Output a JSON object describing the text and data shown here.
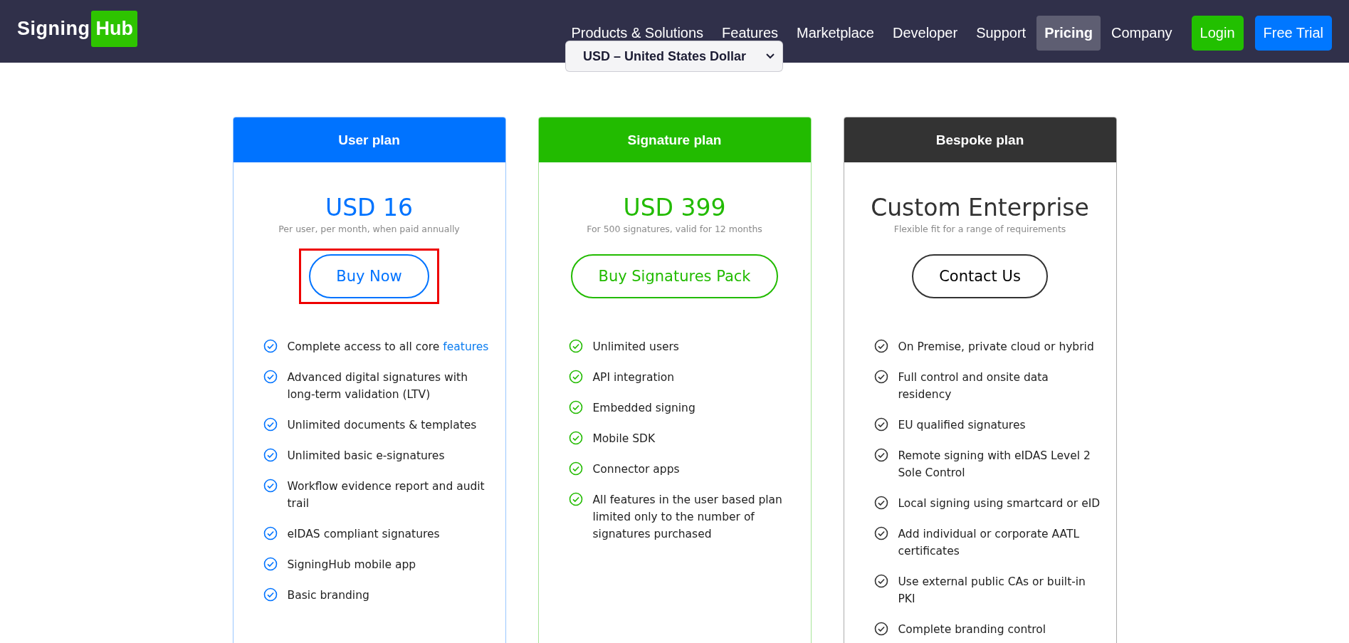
{
  "header": {
    "logo": {
      "word": "Signing",
      "badge": "Hub"
    },
    "nav": [
      {
        "label": "Products & Solutions",
        "selected": false
      },
      {
        "label": "Features",
        "selected": false
      },
      {
        "label": "Marketplace",
        "selected": false
      },
      {
        "label": "Developer",
        "selected": false
      },
      {
        "label": "Support",
        "selected": false
      },
      {
        "label": "Pricing",
        "selected": true
      },
      {
        "label": "Company",
        "selected": false
      }
    ],
    "buttons": [
      {
        "label": "Login",
        "color": "#22c000"
      },
      {
        "label": "Free Trial",
        "color": "#0077ff"
      }
    ]
  },
  "currency_select": {
    "value": "USD – United States Dollar"
  },
  "plans": [
    {
      "title": "User plan",
      "color": "#0073ff",
      "price": "USD 16",
      "note": "Per user, per month, when paid annually",
      "button": "Buy Now",
      "highlighted": true,
      "features": [
        {
          "text": "Complete access to all core",
          "link": "features"
        },
        {
          "text": "Advanced digital signatures with long-term validation (LTV)"
        },
        {
          "text": "Unlimited documents & templates"
        },
        {
          "text": "Unlimited basic e-signatures"
        },
        {
          "text": "Workflow evidence report and audit trail"
        },
        {
          "text": "eIDAS compliant signatures"
        },
        {
          "text": "SigningHub mobile app"
        },
        {
          "text": "Basic branding"
        }
      ]
    },
    {
      "title": "Signature plan",
      "color": "#22bb00",
      "price": "USD 399",
      "note": "For 500 signatures, valid for 12 months",
      "button": "Buy Signatures Pack",
      "highlighted": false,
      "features": [
        {
          "text": "Unlimited users"
        },
        {
          "text": "API integration"
        },
        {
          "text": "Embedded signing"
        },
        {
          "text": "Mobile SDK"
        },
        {
          "text": "Connector apps"
        },
        {
          "text": "All features in the user based plan limited only to the number of signatures purchased"
        }
      ]
    },
    {
      "title": "Bespoke plan",
      "color": "#333333",
      "price": "Custom Enterprise",
      "note": "Flexible fit for a range of requirements",
      "button": "Contact Us",
      "highlighted": false,
      "features": [
        {
          "text": "On Premise, private cloud or hybrid"
        },
        {
          "text": "Full control and onsite data residency"
        },
        {
          "text": "EU qualified signatures"
        },
        {
          "text": "Remote signing with eIDAS Level 2 Sole Control"
        },
        {
          "text": "Local signing using smartcard or eID"
        },
        {
          "text": "Add individual or corporate AATL certificates"
        },
        {
          "text": "Use external public CAs or built-in PKI"
        },
        {
          "text": "Complete branding control"
        }
      ]
    }
  ]
}
